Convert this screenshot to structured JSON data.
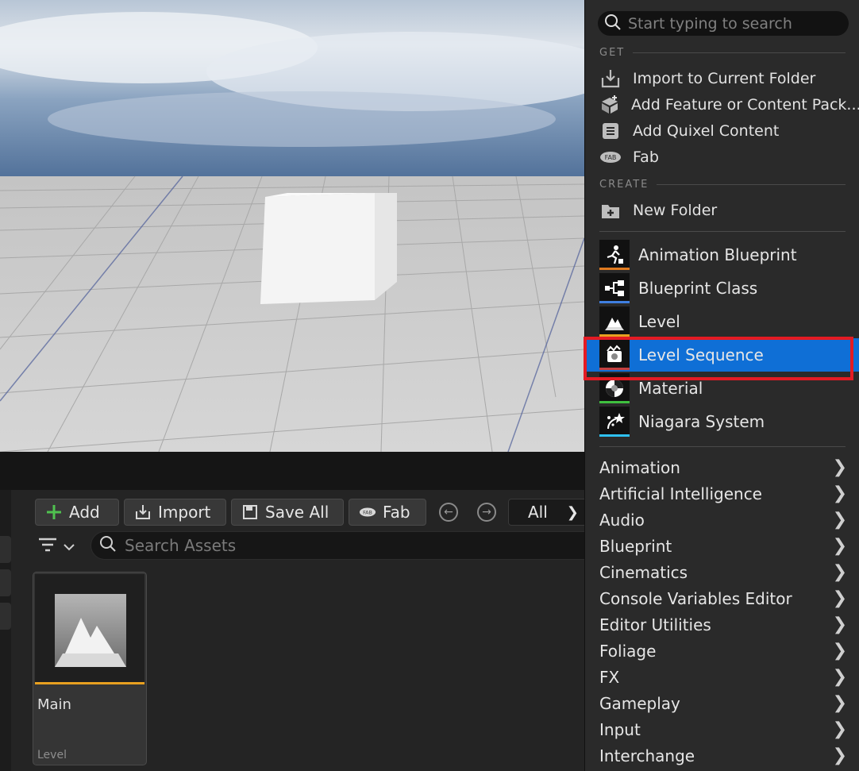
{
  "viewport": {
    "sky_top": "#6f8fb5",
    "sky_bottom": "#eef1f5",
    "floor_color": "#c9c9c9",
    "cube_color": "#f4f4f4"
  },
  "content_browser": {
    "toolbar": {
      "add_label": "Add",
      "import_label": "Import",
      "save_all_label": "Save All",
      "fab_label": "Fab",
      "path_label": "All"
    },
    "search": {
      "placeholder": "Search Assets"
    },
    "asset": {
      "name": "Main",
      "type": "Level",
      "type_color": "#e8a020"
    }
  },
  "menu": {
    "search_placeholder": "Start typing to search",
    "get_header": "GET",
    "get_items": [
      {
        "label": "Import to Current Folder",
        "icon": "import-icon"
      },
      {
        "label": "Add Feature or Content Pack...",
        "icon": "feature-pack-icon"
      },
      {
        "label": "Add Quixel Content",
        "icon": "quixel-icon"
      },
      {
        "label": "Fab",
        "icon": "fab-icon"
      }
    ],
    "create_header": "CREATE",
    "new_folder_label": "New Folder",
    "asset_items": [
      {
        "label": "Animation Blueprint",
        "icon": "animation-blueprint-icon",
        "color": "#e07a1f"
      },
      {
        "label": "Blueprint Class",
        "icon": "blueprint-class-icon",
        "color": "#3f7fe0"
      },
      {
        "label": "Level",
        "icon": "level-icon",
        "color": "#e8a020"
      },
      {
        "label": "Level Sequence",
        "icon": "level-sequence-icon",
        "color": "#c44040"
      },
      {
        "label": "Material",
        "icon": "material-icon",
        "color": "#3fbf3f"
      },
      {
        "label": "Niagara System",
        "icon": "niagara-system-icon",
        "color": "#2fc0f0"
      }
    ],
    "selected_index": 3,
    "categories": [
      "Animation",
      "Artificial Intelligence",
      "Audio",
      "Blueprint",
      "Cinematics",
      "Console Variables Editor",
      "Editor Utilities",
      "Foliage",
      "FX",
      "Gameplay",
      "Input",
      "Interchange"
    ],
    "highlight_color": "#e41b23",
    "selection_color": "#0f6fd6"
  }
}
